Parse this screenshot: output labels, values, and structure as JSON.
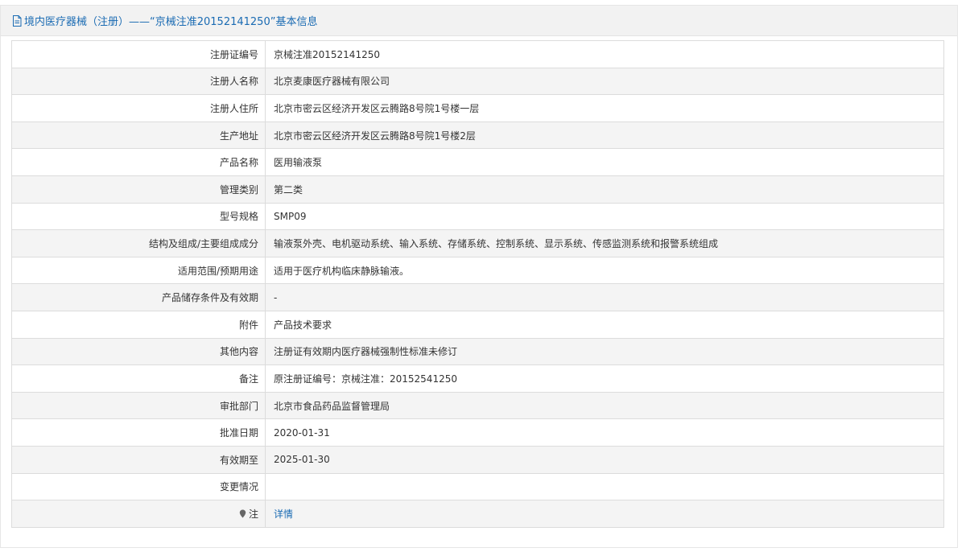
{
  "header": {
    "title": "境内医疗器械（注册）——“京械注准20152141250”基本信息",
    "icon": "document-icon"
  },
  "rows": [
    {
      "label": "注册证编号",
      "value": "京械注准20152141250"
    },
    {
      "label": "注册人名称",
      "value": "北京麦康医疗器械有限公司"
    },
    {
      "label": "注册人住所",
      "value": "北京市密云区经济开发区云腾路8号院1号楼一层"
    },
    {
      "label": "生产地址",
      "value": "北京市密云区经济开发区云腾路8号院1号楼2层"
    },
    {
      "label": "产品名称",
      "value": "医用输液泵"
    },
    {
      "label": "管理类别",
      "value": "第二类"
    },
    {
      "label": "型号规格",
      "value": "SMP09"
    },
    {
      "label": "结构及组成/主要组成成分",
      "value": "输液泵外壳、电机驱动系统、输入系统、存储系统、控制系统、显示系统、传感监测系统和报警系统组成"
    },
    {
      "label": "适用范围/预期用途",
      "value": "适用于医疗机构临床静脉输液。"
    },
    {
      "label": "产品储存条件及有效期",
      "value": "-"
    },
    {
      "label": "附件",
      "value": "产品技术要求"
    },
    {
      "label": "其他内容",
      "value": "注册证有效期内医疗器械强制性标准未修订"
    },
    {
      "label": "备注",
      "value": "原注册证编号：京械注准：20152541250"
    },
    {
      "label": "审批部门",
      "value": "北京市食品药品监督管理局"
    },
    {
      "label": "批准日期",
      "value": "2020-01-31"
    },
    {
      "label": "有效期至",
      "value": "2025-01-30"
    },
    {
      "label": "变更情况",
      "value": ""
    },
    {
      "label": "注",
      "value": "详情",
      "icon": "pin-icon"
    }
  ],
  "colors": {
    "link": "#1a6bb3",
    "header_bg": "#f2f2f2",
    "row_alt_bg": "#f4f4f4",
    "border": "#dcdcdc"
  }
}
